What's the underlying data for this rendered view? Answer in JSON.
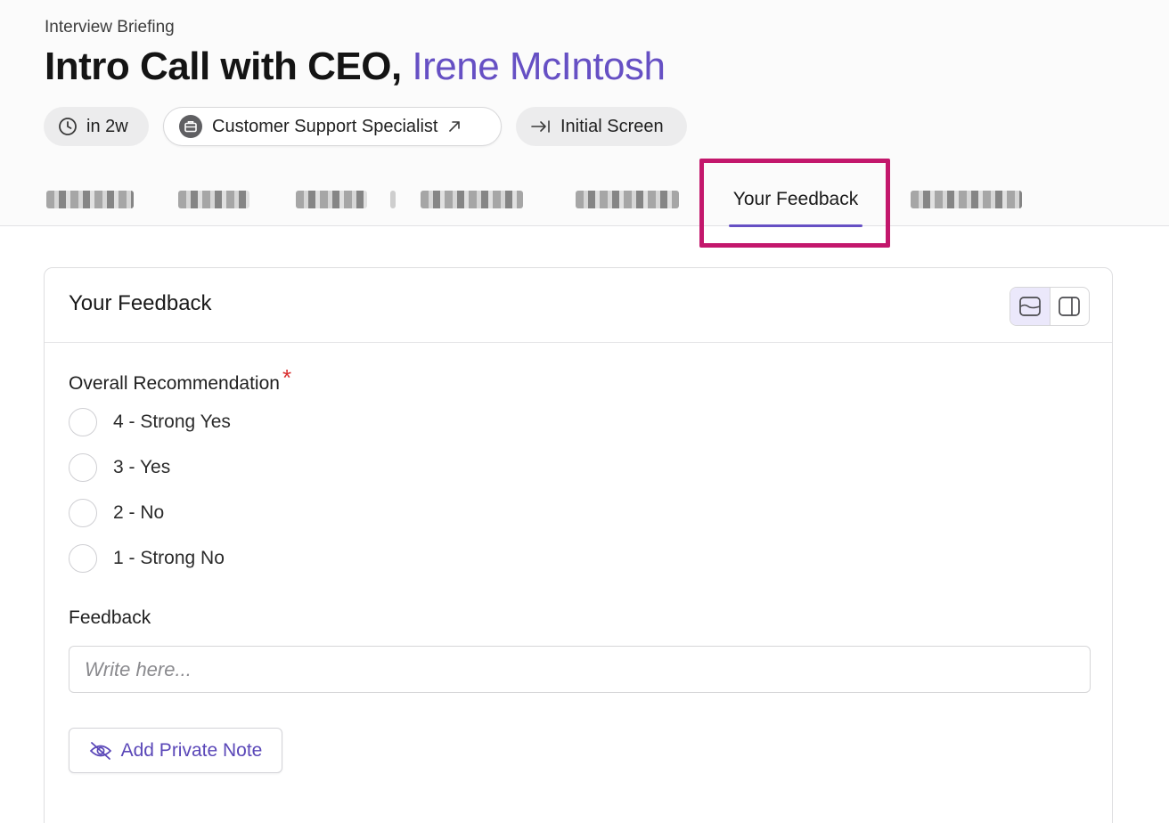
{
  "header": {
    "eyebrow": "Interview Briefing",
    "title_prefix": "Intro Call with CEO,",
    "title_name": "Irene McIntosh",
    "pills": {
      "time": "in 2w",
      "job": "Customer Support Specialist",
      "stage": "Initial Screen"
    }
  },
  "tabs": {
    "active_label": "Your Feedback"
  },
  "feedback_card": {
    "title": "Your Feedback",
    "recommendation_label": "Overall Recommendation",
    "required_mark": "*",
    "options": [
      "4 - Strong Yes",
      "3 - Yes",
      "2 - No",
      "1 - Strong No"
    ],
    "feedback_label": "Feedback",
    "feedback_placeholder": "Write here...",
    "private_note_button": "Add Private Note"
  },
  "colors": {
    "accent": "#6650c4",
    "highlight": "#c3176c",
    "required": "#d92f2f"
  },
  "icons": [
    "clock-icon",
    "briefcase-icon",
    "external-link-icon",
    "arrow-to-bar-icon",
    "stacked-view-icon",
    "side-panel-icon",
    "eye-off-icon"
  ]
}
